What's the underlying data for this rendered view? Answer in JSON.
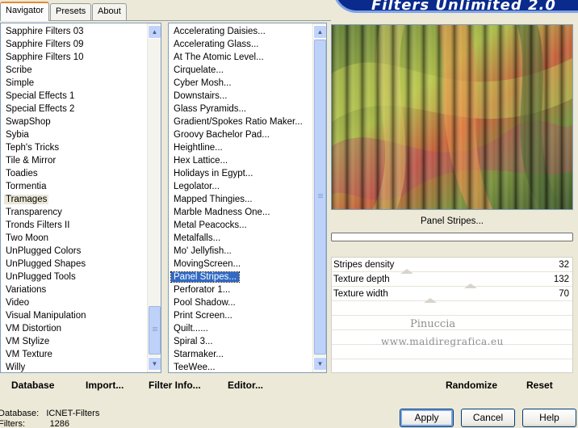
{
  "tabs": {
    "navigator": "Navigator",
    "presets": "Presets",
    "about": "About"
  },
  "banner_title": "Filters Unlimited 2.0",
  "categories": {
    "items": [
      "Sapphire Filters 03",
      "Sapphire Filters 09",
      "Sapphire Filters 10",
      "Scribe",
      "Simple",
      "Special Effects 1",
      "Special Effects 2",
      "SwapShop",
      "Sybia",
      "Teph's Tricks",
      "Tile & Mirror",
      "Toadies",
      "Tormentia",
      "Tramages",
      "Transparency",
      "Tronds Filters II",
      "Two Moon",
      "UnPlugged Colors",
      "UnPlugged Shapes",
      "UnPlugged Tools",
      "Variations",
      "Video",
      "Visual Manipulation",
      "VM Distortion",
      "VM Stylize",
      "VM Texture",
      "Willy"
    ],
    "selected": "Tramages"
  },
  "filters": {
    "items": [
      "Accelerating Daisies...",
      "Accelerating Glass...",
      "At The Atomic Level...",
      "Cirquelate...",
      "Cyber Mosh...",
      "Downstairs...",
      "Glass Pyramids...",
      "Gradient/Spokes Ratio Maker...",
      "Groovy Bachelor Pad...",
      "Heightline...",
      "Hex Lattice...",
      "Holidays in Egypt...",
      "Legolator...",
      "Mapped Thingies...",
      "Marble Madness One...",
      "Metal Peacocks...",
      "Metalfalls...",
      "Mo' Jellyfish...",
      "MovingScreen...",
      "Panel Stripes...",
      "Perforator 1...",
      "Pool Shadow...",
      "Print Screen...",
      "Quilt......",
      "Spiral 3...",
      "Starmaker...",
      "TeeWee..."
    ],
    "selected": "Panel Stripes..."
  },
  "current_filter": "Panel Stripes...",
  "parameters": [
    {
      "label": "Stripes density",
      "value": "32",
      "level": 0.125
    },
    {
      "label": "Texture depth",
      "value": "132",
      "level": 0.52
    },
    {
      "label": "Texture width",
      "value": "70",
      "level": 0.27
    }
  ],
  "watermark": {
    "line1": "Pinuccia",
    "line2": "www.maidiregrafica.eu"
  },
  "bottom_buttons": {
    "database": "Database",
    "import": "Import...",
    "filter_info": "Filter Info...",
    "editor": "Editor...",
    "randomize": "Randomize",
    "reset": "Reset"
  },
  "status": {
    "database_label": "Database:",
    "database_value": "ICNET-Filters",
    "filters_label": "Filters:",
    "filters_value": "1286"
  },
  "dialog_buttons": {
    "apply": "Apply",
    "cancel": "Cancel",
    "help": "Help"
  },
  "colors": {
    "selection": "#316AC5",
    "banner": "#0A2A8C",
    "dialog_bg": "#ECE9D8"
  }
}
